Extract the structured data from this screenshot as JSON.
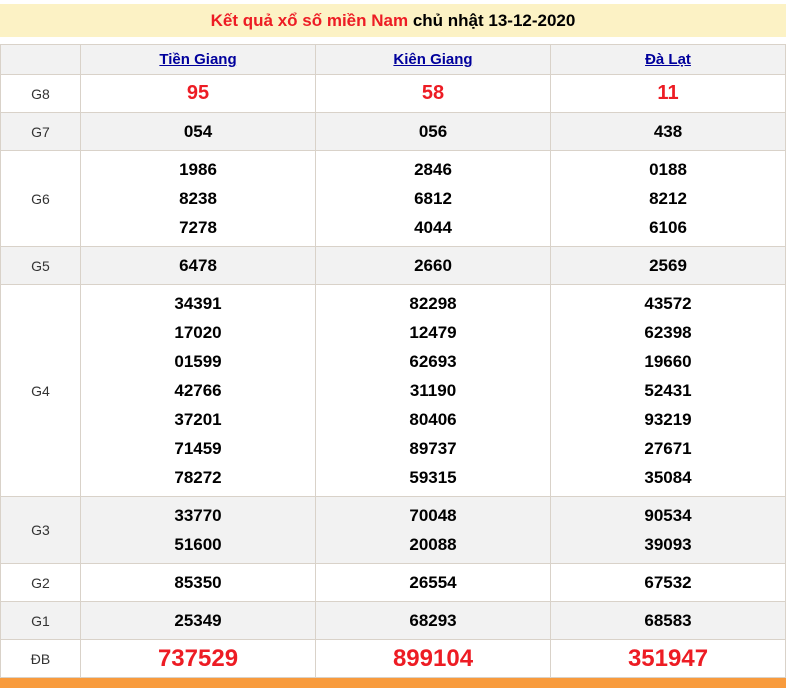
{
  "title": {
    "red_part": "Kết quả xổ số miền Nam",
    "black_part": " chủ nhật 13-12-2020"
  },
  "table": {
    "columns": [
      "Tiền Giang",
      "Kiên Giang",
      "Đà Lạt"
    ],
    "rows": [
      {
        "label": "G8",
        "emphasis": "red-large",
        "cells": [
          [
            "95"
          ],
          [
            "58"
          ],
          [
            "11"
          ]
        ]
      },
      {
        "label": "G7",
        "emphasis": "normal",
        "cells": [
          [
            "054"
          ],
          [
            "056"
          ],
          [
            "438"
          ]
        ]
      },
      {
        "label": "G6",
        "emphasis": "normal",
        "cells": [
          [
            "1986",
            "8238",
            "7278"
          ],
          [
            "2846",
            "6812",
            "4044"
          ],
          [
            "0188",
            "8212",
            "6106"
          ]
        ]
      },
      {
        "label": "G5",
        "emphasis": "normal",
        "cells": [
          [
            "6478"
          ],
          [
            "2660"
          ],
          [
            "2569"
          ]
        ]
      },
      {
        "label": "G4",
        "emphasis": "normal",
        "cells": [
          [
            "34391",
            "17020",
            "01599",
            "42766",
            "37201",
            "71459",
            "78272"
          ],
          [
            "82298",
            "12479",
            "62693",
            "31190",
            "80406",
            "89737",
            "59315"
          ],
          [
            "43572",
            "62398",
            "19660",
            "52431",
            "93219",
            "27671",
            "35084"
          ]
        ]
      },
      {
        "label": "G3",
        "emphasis": "normal",
        "cells": [
          [
            "33770",
            "51600"
          ],
          [
            "70048",
            "20088"
          ],
          [
            "90534",
            "39093"
          ]
        ]
      },
      {
        "label": "G2",
        "emphasis": "normal",
        "cells": [
          [
            "85350"
          ],
          [
            "26554"
          ],
          [
            "67532"
          ]
        ]
      },
      {
        "label": "G1",
        "emphasis": "normal",
        "cells": [
          [
            "25349"
          ],
          [
            "68293"
          ],
          [
            "68583"
          ]
        ]
      },
      {
        "label": "ĐB",
        "emphasis": "red-xlarge",
        "cells": [
          [
            "737529"
          ],
          [
            "899104"
          ],
          [
            "351947"
          ]
        ]
      }
    ]
  },
  "colors": {
    "title_red": "#ED1C24",
    "number_red": "#ED1C24",
    "header_bg": "#FCF2C5",
    "link_blue": "#00009C",
    "row_alt_bg": "#F2F2F2",
    "border": "#D9D2C9",
    "footer_orange": "#F89B3D"
  }
}
